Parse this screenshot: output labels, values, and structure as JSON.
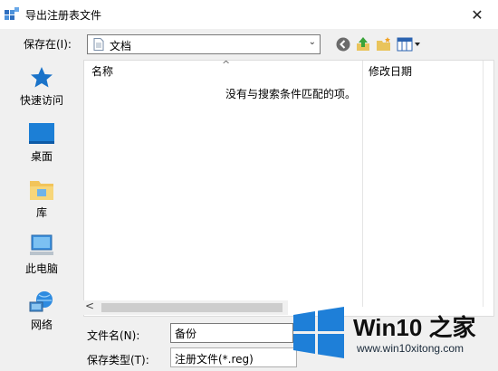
{
  "window": {
    "title": "导出注册表文件"
  },
  "toolbar": {
    "save_in_label": "保存在(I):",
    "location_value": "文档"
  },
  "places": [
    {
      "label": "快速访问",
      "icon": "star-icon"
    },
    {
      "label": "桌面",
      "icon": "desktop-icon"
    },
    {
      "label": "库",
      "icon": "library-folder-icon"
    },
    {
      "label": "此电脑",
      "icon": "computer-icon"
    },
    {
      "label": "网络",
      "icon": "network-icon"
    }
  ],
  "filelist": {
    "columns": [
      "名称",
      "修改日期"
    ],
    "empty_message": "没有与搜索条件匹配的项。"
  },
  "form": {
    "filename_label": "文件名(N):",
    "filename_value": "备份",
    "filetype_label": "保存类型(T):",
    "filetype_value": "注册文件(*.reg)"
  },
  "watermark": {
    "text": "Win10 之家",
    "url": "www.win10xitong.com"
  },
  "colors": {
    "accent": "#0078d7",
    "logo_blue": "#1e7fd8"
  }
}
